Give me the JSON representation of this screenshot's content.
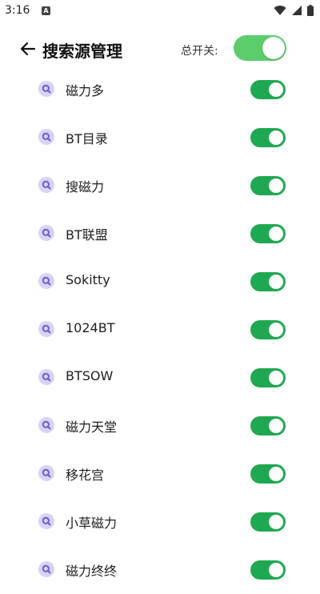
{
  "status_bar": {
    "time": "3:16",
    "notification_icon": "A"
  },
  "header": {
    "title": "搜索源管理",
    "master_switch_label": "总开关:",
    "master_switch_on": true
  },
  "colors": {
    "master_toggle": "#5ccd6b",
    "row_toggle": "#1fa852",
    "icon_bg": "#d9d3f6",
    "icon_fg": "#6b5bd6"
  },
  "sources": [
    {
      "name": "磁力多",
      "enabled": true
    },
    {
      "name": "BT目录",
      "enabled": true
    },
    {
      "name": "搜磁力",
      "enabled": true
    },
    {
      "name": "BT联盟",
      "enabled": true
    },
    {
      "name": "Sokitty",
      "enabled": true
    },
    {
      "name": "1024BT",
      "enabled": true
    },
    {
      "name": "BTSOW",
      "enabled": true
    },
    {
      "name": "磁力天堂",
      "enabled": true
    },
    {
      "name": "移花宫",
      "enabled": true
    },
    {
      "name": "小草磁力",
      "enabled": true
    },
    {
      "name": "磁力终终",
      "enabled": true
    }
  ]
}
